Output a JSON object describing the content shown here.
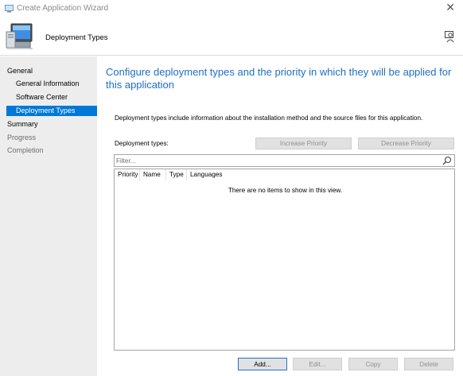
{
  "window": {
    "title": "Create Application Wizard",
    "close_glyph": "✕"
  },
  "header": {
    "page_title": "Deployment Types",
    "icon": "computer-wizard-icon",
    "help_icon": "help-person-icon"
  },
  "sidebar": {
    "items": [
      {
        "label": "General",
        "level": "group",
        "state": "normal"
      },
      {
        "label": "General Information",
        "level": "sub",
        "state": "normal"
      },
      {
        "label": "Software Center",
        "level": "sub",
        "state": "normal"
      },
      {
        "label": "Deployment Types",
        "level": "sub",
        "state": "active"
      },
      {
        "label": "Summary",
        "level": "group",
        "state": "normal"
      },
      {
        "label": "Progress",
        "level": "group",
        "state": "disabled"
      },
      {
        "label": "Completion",
        "level": "group",
        "state": "disabled"
      }
    ]
  },
  "main": {
    "title": "Configure deployment types and the priority in which they will be applied for this application",
    "description": "Deployment types include information about the installation method and the source files for this application.",
    "deployment_types_label": "Deployment types:",
    "increase_priority_label": "Increase Priority",
    "decrease_priority_label": "Decrease Priority",
    "filter": {
      "placeholder": "Filter...",
      "value": ""
    },
    "list": {
      "columns": [
        "Priority",
        "Name",
        "Type",
        "Languages"
      ],
      "rows": [],
      "empty_message": "There are no items to show in this view."
    },
    "buttons": {
      "add": "Add...",
      "edit": "Edit...",
      "copy": "Copy",
      "delete": "Delete"
    }
  },
  "colors": {
    "accent": "#0078d7",
    "title_blue": "#1e6fc2",
    "sidebar_bg": "#ededed"
  }
}
